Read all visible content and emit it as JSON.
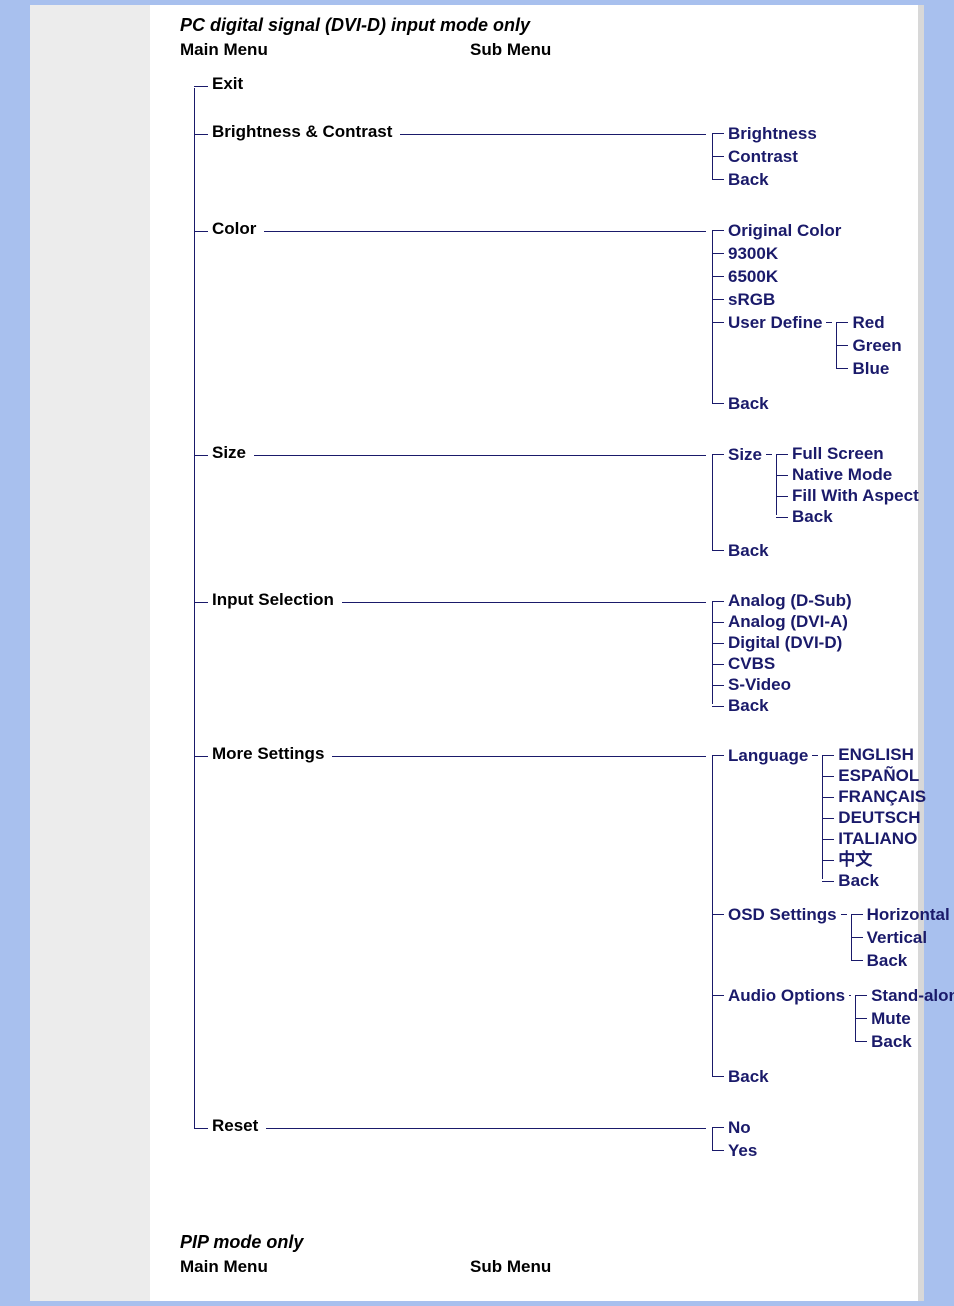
{
  "section1": {
    "title": "PC digital signal (DVI-D) input mode only",
    "header_main": "Main Menu",
    "header_sub": "Sub Menu",
    "items": {
      "exit": "Exit",
      "brightness_contrast": {
        "label": "Brightness & Contrast",
        "sub": [
          "Brightness",
          "Contrast",
          "Back"
        ]
      },
      "color": {
        "label": "Color",
        "sub": {
          "original": "Original Color",
          "k9300": "9300K",
          "k6500": "6500K",
          "srgb": "sRGB",
          "user_define": {
            "label": "User Define",
            "sub": [
              "Red",
              "Green",
              "Blue"
            ]
          },
          "back": "Back"
        }
      },
      "size": {
        "label": "Size",
        "sub": {
          "size": {
            "label": "Size",
            "sub": [
              "Full Screen",
              "Native Mode",
              "Fill With Aspect",
              "Back"
            ]
          },
          "back": "Back"
        }
      },
      "input_selection": {
        "label": "Input Selection",
        "sub": [
          "Analog (D-Sub)",
          "Analog (DVI-A)",
          "Digital (DVI-D)",
          "CVBS",
          "S-Video",
          "Back"
        ]
      },
      "more_settings": {
        "label": "More Settings",
        "sub": {
          "language": {
            "label": "Language",
            "sub": [
              "ENGLISH",
              "ESPAÑOL",
              "FRANÇAIS",
              "DEUTSCH",
              "ITALIANO",
              "中文",
              "Back"
            ]
          },
          "osd": {
            "label": "OSD Settings",
            "sub": [
              "Horizontal",
              "Vertical",
              "Back"
            ]
          },
          "audio": {
            "label": "Audio Options",
            "sub": [
              "Stand-alone",
              "Mute",
              "Back"
            ]
          },
          "back": "Back"
        }
      },
      "reset": {
        "label": "Reset",
        "sub": [
          "No",
          "Yes"
        ]
      }
    }
  },
  "section2": {
    "title": "PIP mode only",
    "header_main": "Main Menu",
    "header_sub": "Sub Menu"
  }
}
